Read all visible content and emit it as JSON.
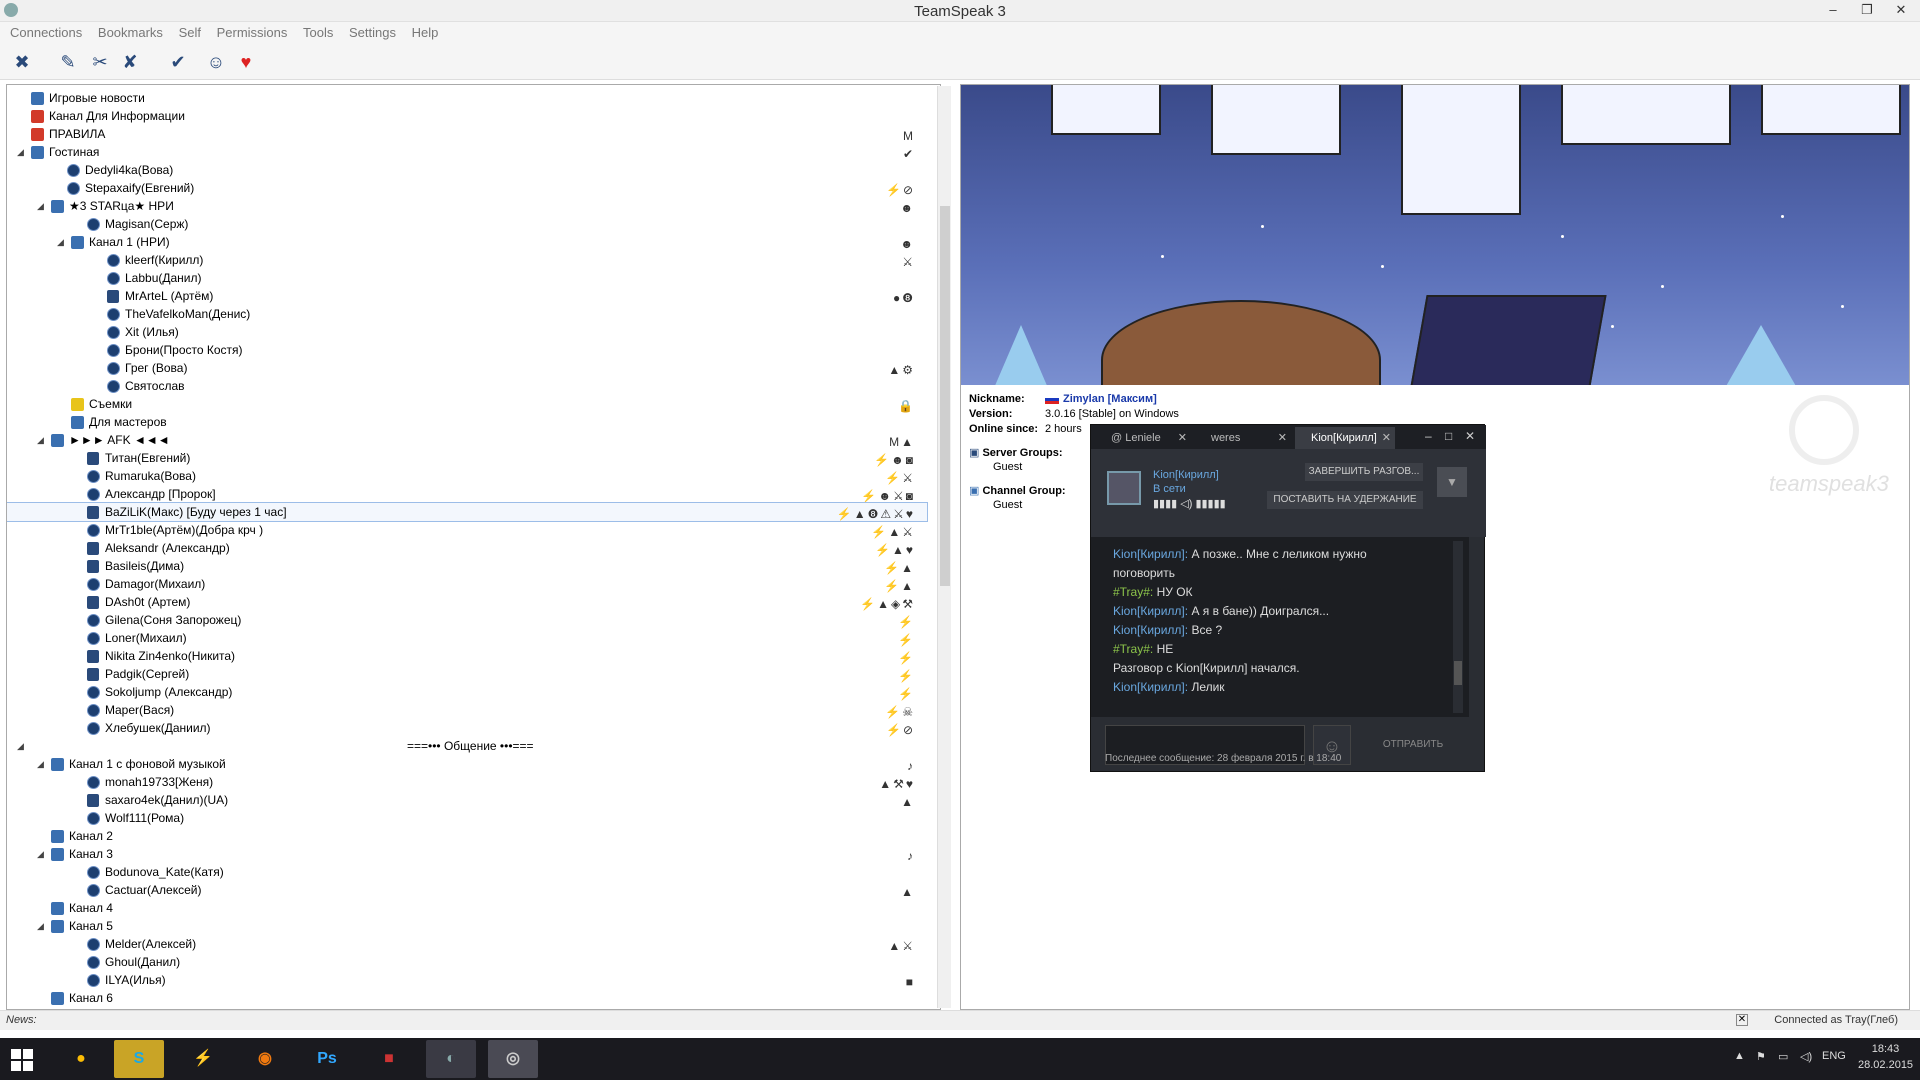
{
  "window": {
    "title": "TeamSpeak 3",
    "minimize": "–",
    "maximize": "❐",
    "close": "✕"
  },
  "menu": [
    "Connections",
    "Bookmarks",
    "Self",
    "Permissions",
    "Tools",
    "Settings",
    "Help"
  ],
  "tree": [
    {
      "label": "Игровые новости",
      "kind": "chan",
      "indent": 0
    },
    {
      "label": "Канал Для Информации",
      "kind": "spec",
      "indent": 0
    },
    {
      "label": "ПРАВИЛА",
      "kind": "spec",
      "indent": 0,
      "icons": "M"
    },
    {
      "label": "Гостиная",
      "kind": "chan",
      "indent": 0,
      "expander": "◢",
      "icons": "✔"
    },
    {
      "label": "Dedyli4ka(Вова)",
      "kind": "user",
      "indent": 1
    },
    {
      "label": "Stepaxaify(Евгений)",
      "kind": "user",
      "indent": 1,
      "icons": "⚡⊘"
    },
    {
      "label": "★3 STARцa★ НРИ",
      "kind": "chan",
      "indent": 1,
      "expander": "◢",
      "icons": "☻"
    },
    {
      "label": "Magisan(Серж)",
      "kind": "user",
      "indent": 2
    },
    {
      "label": "Канал 1 (НРИ)",
      "kind": "chan",
      "indent": 2,
      "expander": "◢",
      "icons": "☻"
    },
    {
      "label": "kleerf(Кирилл)",
      "kind": "user",
      "indent": 3,
      "icons": "⚔"
    },
    {
      "label": "Labbu(Данил)",
      "kind": "user",
      "indent": 3
    },
    {
      "label": "MrArteL (Артём)",
      "kind": "away",
      "indent": 3,
      "icons": "●❽"
    },
    {
      "label": "TheVafelkoMan(Денис)",
      "kind": "user",
      "indent": 3
    },
    {
      "label": "Xit (Илья)",
      "kind": "user",
      "indent": 3
    },
    {
      "label": "Брони(Просто Костя)",
      "kind": "user",
      "indent": 3
    },
    {
      "label": "Грег (Вова)",
      "kind": "user",
      "indent": 3,
      "icons": "▲⚙"
    },
    {
      "label": "Святослав",
      "kind": "user",
      "indent": 3
    },
    {
      "label": "Съемки",
      "kind": "yel",
      "indent": 2,
      "icons": "🔒"
    },
    {
      "label": "Для мастеров",
      "kind": "chan",
      "indent": 2
    },
    {
      "label": "►►► AFK ◄◄◄",
      "kind": "chan",
      "indent": 1,
      "expander": "◢",
      "icons": "M▲"
    },
    {
      "label": "Титан(Евгений)",
      "kind": "away",
      "indent": 2,
      "icons": "⚡☻◙"
    },
    {
      "label": "Rumaruka(Вова)",
      "kind": "user",
      "indent": 2,
      "icons": "⚡⚔"
    },
    {
      "label": "Александр [Пророк]",
      "kind": "user",
      "indent": 2,
      "icons": "⚡☻⚔◙"
    },
    {
      "label": "BaZiLiK(Макс) [Буду через 1 час]",
      "kind": "away",
      "indent": 2,
      "selected": true,
      "icons": "⚡▲❽⚠⚔♥"
    },
    {
      "label": "MrTr1ble(Артём)(Добра крч )",
      "kind": "user",
      "indent": 2,
      "icons": "⚡▲⚔"
    },
    {
      "label": "Aleksandr (Александр)",
      "kind": "away",
      "indent": 2,
      "icons": "⚡▲♥"
    },
    {
      "label": "Basileis(Дима)",
      "kind": "away",
      "indent": 2,
      "icons": "⚡▲"
    },
    {
      "label": "Damagor(Михаил)",
      "kind": "user",
      "indent": 2,
      "icons": "⚡▲"
    },
    {
      "label": "DAsh0t (Артем)",
      "kind": "away",
      "indent": 2,
      "icons": "⚡▲◈⚒"
    },
    {
      "label": "Gilena(Соня Запорожец)",
      "kind": "user",
      "indent": 2,
      "icons": "⚡"
    },
    {
      "label": "Loner(Михаил)",
      "kind": "user",
      "indent": 2,
      "icons": "⚡"
    },
    {
      "label": "Nikita Zin4enko(Никита)",
      "kind": "away",
      "indent": 2,
      "icons": "⚡"
    },
    {
      "label": "Padgik(Сергей)",
      "kind": "away",
      "indent": 2,
      "icons": "⚡"
    },
    {
      "label": "Sokoljump (Александр)",
      "kind": "user",
      "indent": 2,
      "icons": "⚡"
    },
    {
      "label": "Maper(Вася)",
      "kind": "user",
      "indent": 2,
      "icons": "⚡☠"
    },
    {
      "label": "Хлебушек(Даниил)",
      "kind": "user",
      "indent": 2,
      "icons": "⚡⊘"
    },
    {
      "label": "===••• Общение •••===",
      "kind": "spacer",
      "indent": 0,
      "expander": "◢"
    },
    {
      "label": "Канал 1 с фоновой музыкой",
      "kind": "chan",
      "indent": 1,
      "expander": "◢",
      "icons": "♪"
    },
    {
      "label": "monah19733[Женя)",
      "kind": "user",
      "indent": 2,
      "icons": "▲⚒♥"
    },
    {
      "label": "saxaro4ek(Данил)(UA)",
      "kind": "away",
      "indent": 2,
      "icons": "▲"
    },
    {
      "label": "Wolf111(Рома)",
      "kind": "user",
      "indent": 2
    },
    {
      "label": "Канал 2",
      "kind": "chan",
      "indent": 1
    },
    {
      "label": "Канал 3",
      "kind": "chan",
      "indent": 1,
      "expander": "◢",
      "icons": "♪"
    },
    {
      "label": "Bodunova_Kate(Катя)",
      "kind": "user",
      "indent": 2
    },
    {
      "label": "Cactuar(Алексей)",
      "kind": "user",
      "indent": 2,
      "icons": "▲"
    },
    {
      "label": "Канал 4",
      "kind": "chan",
      "indent": 1
    },
    {
      "label": "Канал 5",
      "kind": "chan",
      "indent": 1,
      "expander": "◢"
    },
    {
      "label": "Melder(Алексей)",
      "kind": "user",
      "indent": 2,
      "icons": "▲⚔"
    },
    {
      "label": "Ghoul(Данил)",
      "kind": "user",
      "indent": 2
    },
    {
      "label": "ILYA(Илья)",
      "kind": "user",
      "indent": 2,
      "icons": "■"
    },
    {
      "label": "Канал 6",
      "kind": "chan",
      "indent": 1
    }
  ],
  "info": {
    "nickname_label": "Nickname:",
    "nickname": "Zimylan [Максим]",
    "version_label": "Version:",
    "version": "3.0.16 [Stable] on Windows",
    "online_label": "Online since:",
    "online": "2 hours",
    "server_groups_label": "Server Groups:",
    "server_group": "Guest",
    "channel_group_label": "Channel Group:",
    "channel_group": "Guest",
    "logo_text": "teamspeak3"
  },
  "chat": {
    "tabs": [
      "@ Leniele",
      "weres",
      "Kion[Кирилл]"
    ],
    "user": "Kion[Кирилл]",
    "status": "В сети",
    "end_button": "ЗАВЕРШИТЬ РАЗГОВ...",
    "hold_button": "ПОСТАВИТЬ НА УДЕРЖАНИЕ",
    "messages": [
      {
        "name": "Kion[Кирилл]:",
        "text": "А позже.. Мне с леликом нужно",
        "kind": "n"
      },
      {
        "name": "",
        "text": "поговорить",
        "kind": "n"
      },
      {
        "name": "#Tray#:",
        "text": "НУ ОК",
        "kind": "g"
      },
      {
        "name": "Kion[Кирилл]:",
        "text": "А я в бане)) Доигрался...",
        "kind": "n"
      },
      {
        "name": "Kion[Кирилл]:",
        "text": "Все ?",
        "kind": "n"
      },
      {
        "name": "#Tray#:",
        "text": "НЕ",
        "kind": "g"
      },
      {
        "name": "",
        "text": "Разговор с Kion[Кирилл] начался.",
        "kind": "n"
      },
      {
        "name": "Kion[Кирилл]:",
        "text": "Лелик",
        "kind": "n"
      }
    ],
    "send": "ОТПРАВИТЬ",
    "footer": "Последнее сообщение: 28 февраля 2015 г. в 18:40"
  },
  "status": {
    "news": "News:",
    "connected": "Connected as Tray(Глеб)"
  },
  "taskbar": {
    "lang": "ENG",
    "time": "18:43",
    "date": "28.02.2015"
  }
}
